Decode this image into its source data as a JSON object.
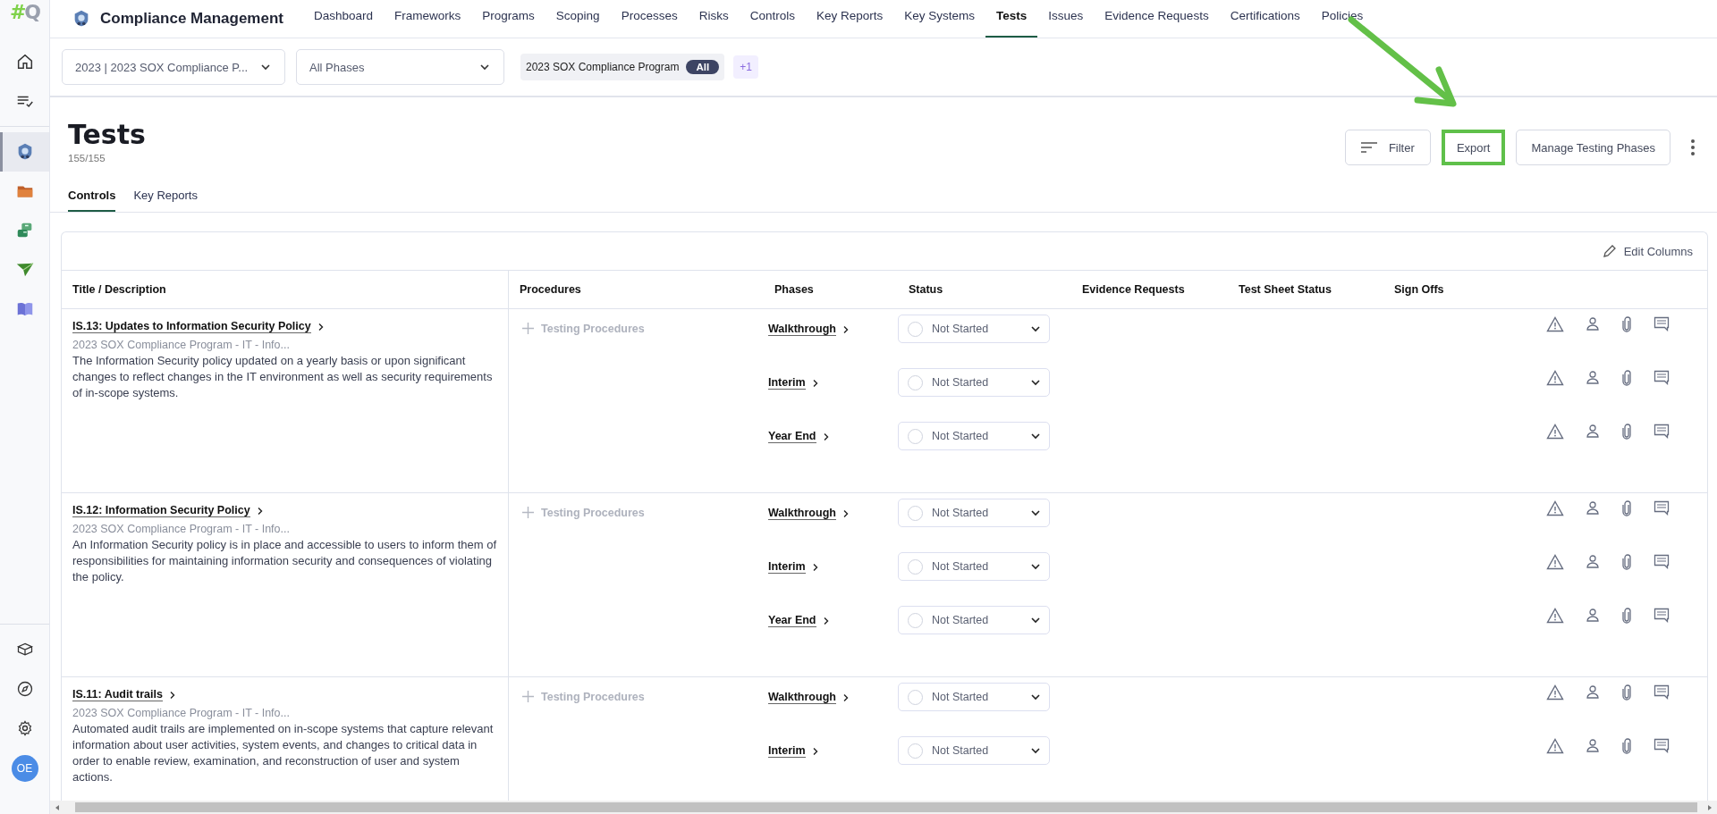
{
  "sidebar": {
    "logo": "#Q",
    "items": [
      {
        "kind": "home",
        "selected": false
      },
      {
        "kind": "tasks",
        "selected": false
      },
      {
        "kind": "compliance",
        "selected": true
      },
      {
        "kind": "folder",
        "selected": false
      },
      {
        "kind": "boxes",
        "selected": false
      },
      {
        "kind": "plane",
        "selected": false
      },
      {
        "kind": "book",
        "selected": false
      }
    ],
    "bottom_items": [
      {
        "kind": "cube"
      },
      {
        "kind": "compass"
      },
      {
        "kind": "settings"
      }
    ],
    "avatar": "OE"
  },
  "app": {
    "title": "Compliance Management"
  },
  "nav": [
    {
      "label": "Dashboard",
      "selected": false
    },
    {
      "label": "Frameworks",
      "selected": false
    },
    {
      "label": "Programs",
      "selected": false
    },
    {
      "label": "Scoping",
      "selected": false
    },
    {
      "label": "Processes",
      "selected": false
    },
    {
      "label": "Risks",
      "selected": false
    },
    {
      "label": "Controls",
      "selected": false
    },
    {
      "label": "Key Reports",
      "selected": false
    },
    {
      "label": "Key Systems",
      "selected": false
    },
    {
      "label": "Tests",
      "selected": true
    },
    {
      "label": "Issues",
      "selected": false
    },
    {
      "label": "Evidence Requests",
      "selected": false
    },
    {
      "label": "Certifications",
      "selected": false
    },
    {
      "label": "Policies",
      "selected": false
    }
  ],
  "filters": {
    "program": "2023 | 2023 SOX Compliance P...",
    "phase": "All Phases",
    "chip": {
      "label": "2023 SOX Compliance Program",
      "badge": "All"
    },
    "more": "+1"
  },
  "page": {
    "title": "Tests",
    "count": "155/155"
  },
  "actions": [
    {
      "kind": "filter",
      "label": "Filter",
      "highlighted": false
    },
    {
      "kind": "plain",
      "label": "Export",
      "highlighted": true
    },
    {
      "kind": "plain",
      "label": "Manage Testing Phases",
      "highlighted": false
    }
  ],
  "tabs": [
    {
      "label": "Controls",
      "selected": true
    },
    {
      "label": "Key Reports",
      "selected": false
    }
  ],
  "table": {
    "edit_columns": "Edit Columns",
    "columns": [
      "Title / Description",
      "Procedures",
      "Phases",
      "Status",
      "Evidence Requests",
      "Test Sheet Status",
      "Sign Offs"
    ],
    "rows": [
      {
        "title": "IS.13: Updates to Information Security Policy",
        "program": "2023 SOX Compliance Program - IT - Info...",
        "description": "The Information Security policy updated on a yearly basis or upon significant changes to reflect changes in the IT environment as well as security requirements of in-scope systems.",
        "procedures": "Testing Procedures",
        "phases": [
          {
            "name": "Walkthrough",
            "status": "Not Started"
          },
          {
            "name": "Interim",
            "status": "Not Started"
          },
          {
            "name": "Year End",
            "status": "Not Started"
          }
        ]
      },
      {
        "title": "IS.12: Information Security Policy",
        "program": "2023 SOX Compliance Program - IT - Info...",
        "description": "An Information Security policy is in place and accessible to users to inform them of responsibilities for maintaining information security and consequences of violating the policy.",
        "procedures": "Testing Procedures",
        "phases": [
          {
            "name": "Walkthrough",
            "status": "Not Started"
          },
          {
            "name": "Interim",
            "status": "Not Started"
          },
          {
            "name": "Year End",
            "status": "Not Started"
          }
        ]
      },
      {
        "title": "IS.11: Audit trails",
        "program": "2023 SOX Compliance Program - IT - Info...",
        "description": "Automated audit trails are implemented on in-scope systems that capture relevant information about user activities, system events, and changes to critical data in order to enable review, examination, and reconstruction of user and system actions.",
        "procedures": "Testing Procedures",
        "phases": [
          {
            "name": "Walkthrough",
            "status": "Not Started"
          },
          {
            "name": "Interim",
            "status": "Not Started"
          }
        ]
      }
    ]
  }
}
